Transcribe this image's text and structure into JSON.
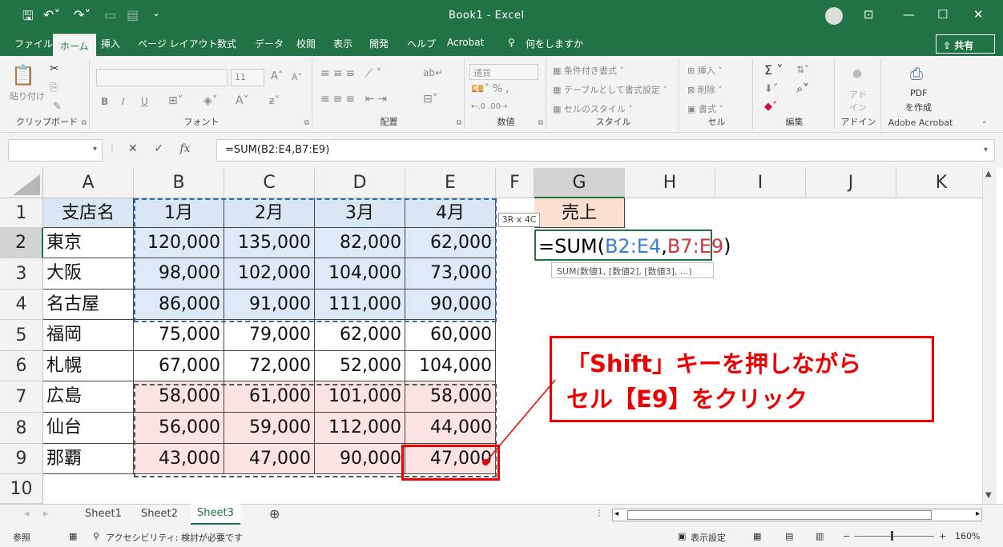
{
  "titlebar": {
    "title": "Book1 - Excel",
    "share": "共有"
  },
  "tabs": [
    "ファイル",
    "ホーム",
    "挿入",
    "ページ レイアウト",
    "数式",
    "データ",
    "校閲",
    "表示",
    "開発",
    "ヘルプ",
    "Acrobat",
    "何をしますか"
  ],
  "ribbon": {
    "clipboard": {
      "paste": "貼り付け",
      "label": "クリップボード"
    },
    "font": {
      "size": "11",
      "label": "フォント",
      "bold": "B",
      "italic": "I",
      "underline": "U"
    },
    "alignment": {
      "label": "配置"
    },
    "number": {
      "format": "通貨",
      "label": "数値"
    },
    "styles": {
      "cond": "条件付き書式",
      "table": "テーブルとして書式設定",
      "cell": "セルのスタイル",
      "label": "スタイル"
    },
    "cells": {
      "insert": "挿入",
      "delete": "削除",
      "format": "書式",
      "label": "セル"
    },
    "editing": {
      "label": "編集",
      "sigma": "Σ"
    },
    "addin": {
      "btn": "アド\nイン",
      "label": "アドイン"
    },
    "acrobat": {
      "btn1": "PDF",
      "btn2": "を作成",
      "label": "Adobe Acrobat"
    }
  },
  "formula": {
    "fx": "fx",
    "value": "=SUM(B2:E4,B7:E9)"
  },
  "columns": [
    "A",
    "B",
    "C",
    "D",
    "E",
    "F",
    "G",
    "H",
    "I",
    "J",
    "K"
  ],
  "rows": [
    "1",
    "2",
    "3",
    "4",
    "5",
    "6",
    "7",
    "8",
    "9",
    "10"
  ],
  "table": {
    "header": [
      "支店名",
      "1月",
      "2月",
      "3月",
      "4月"
    ],
    "data": [
      [
        "東京",
        "120,000",
        "135,000",
        "82,000",
        "62,000"
      ],
      [
        "大阪",
        "98,000",
        "102,000",
        "104,000",
        "73,000"
      ],
      [
        "名古屋",
        "86,000",
        "91,000",
        "111,000",
        "90,000"
      ],
      [
        "福岡",
        "75,000",
        "79,000",
        "62,000",
        "60,000"
      ],
      [
        "札幌",
        "67,000",
        "72,000",
        "52,000",
        "104,000"
      ],
      [
        "広島",
        "58,000",
        "61,000",
        "101,000",
        "58,000"
      ],
      [
        "仙台",
        "56,000",
        "59,000",
        "112,000",
        "44,000"
      ],
      [
        "那覇",
        "43,000",
        "47,000",
        "90,000",
        "47,000"
      ]
    ]
  },
  "g1": "売上",
  "edit": {
    "prefix": "=SUM(",
    "ref1": "B2:E4",
    "comma": ",",
    "ref2": "B7:E9",
    "suffix": ")"
  },
  "tooltip": "SUM(数値1, [数値2], [数値3], ...)",
  "dims": "3R x 4C",
  "callout": {
    "line1": "「Shift」キーを押しながら",
    "line2": "セル【E9】をクリック"
  },
  "sheets": [
    "Sheet1",
    "Sheet2",
    "Sheet3"
  ],
  "status": {
    "mode": "参照",
    "access": "アクセシビリティ: 検討が必要です",
    "display": "表示設定",
    "zoom": "160%"
  }
}
